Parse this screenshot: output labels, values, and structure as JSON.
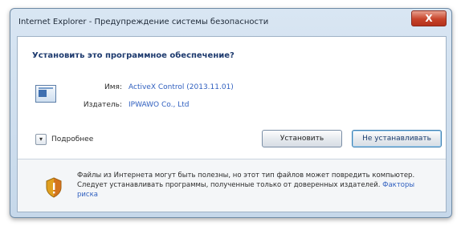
{
  "window": {
    "title": "Internet Explorer - Предупреждение системы безопасности",
    "close_label": "X"
  },
  "dialog": {
    "question": "Установить это программное обеспечение?",
    "name_label": "Имя:",
    "name_value": "ActiveX Control (2013.11.01)",
    "publisher_label": "Издатель:",
    "publisher_value": "IPWAWO Co., Ltd",
    "details_label": "Подробнее",
    "install_button": "Установить",
    "dont_install_button": "Не устанавливать"
  },
  "warning": {
    "text": "Файлы из Интернета могут быть полезны, но этот тип файлов может повредить компьютер. Следует устанавливать программы, полученные только от доверенных издателей.",
    "link": "Факторы риска"
  },
  "colors": {
    "accent": "#2f5fbf",
    "close_red": "#c7432a"
  },
  "icons": {
    "app": "program-icon",
    "warning": "shield-warning-icon",
    "expand": "chevron-down-icon"
  }
}
